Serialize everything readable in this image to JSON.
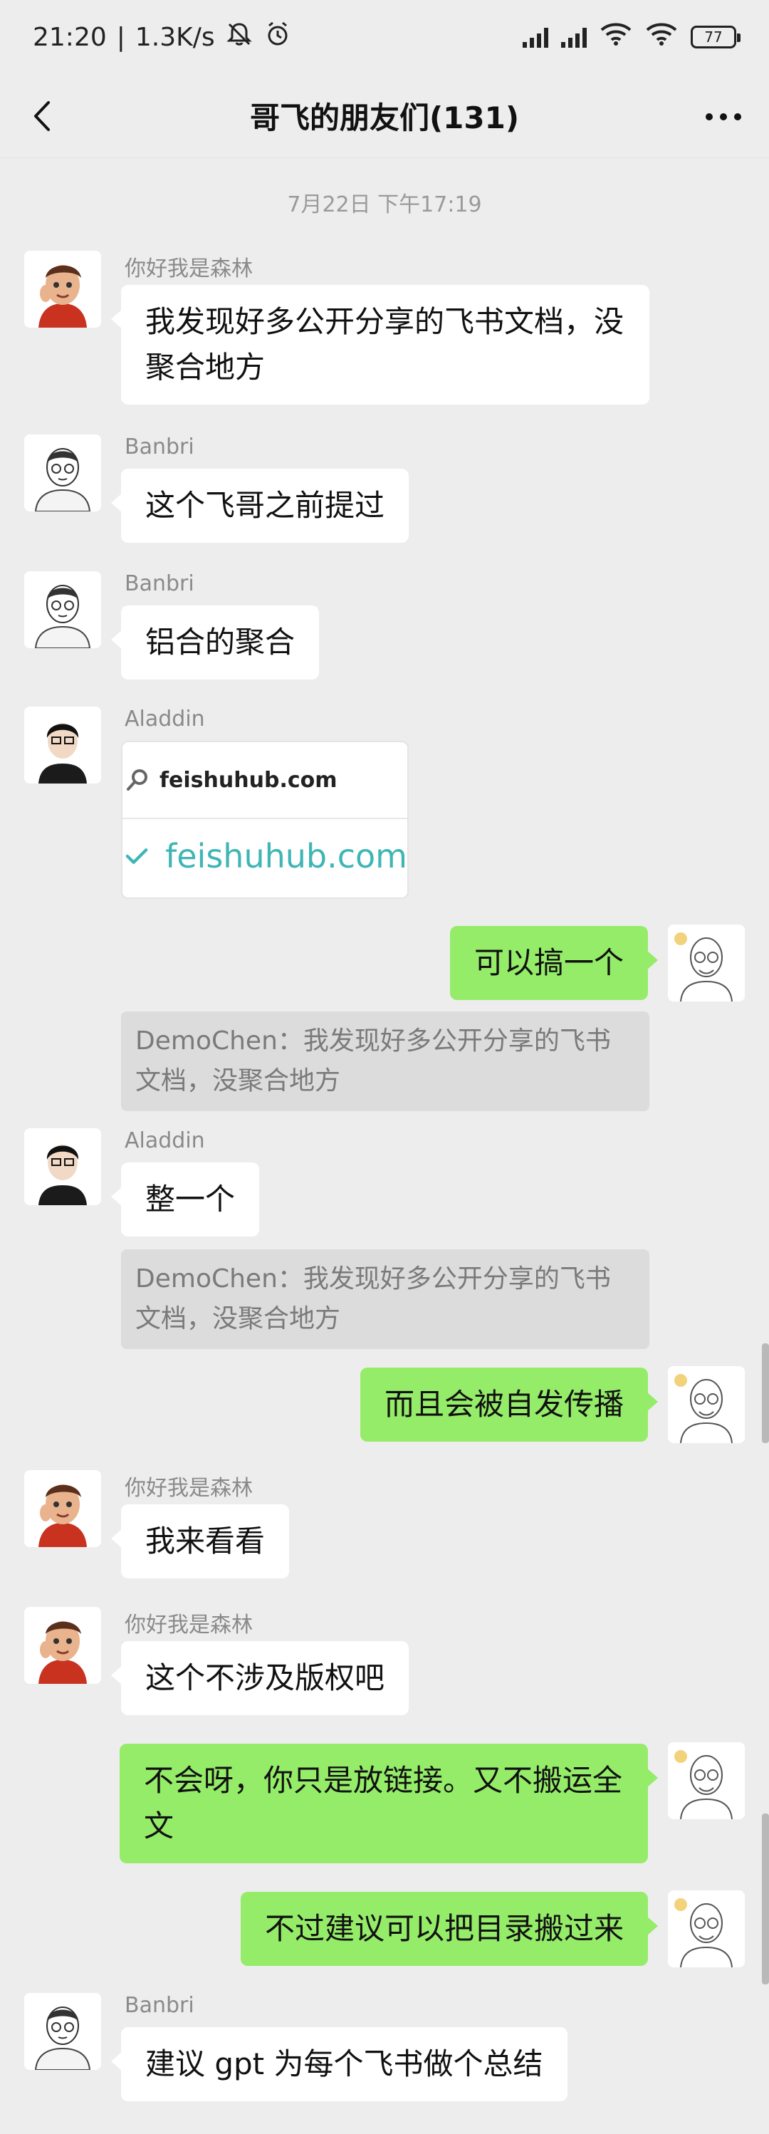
{
  "status_bar": {
    "time": "21:20",
    "speed": "1.3K/s",
    "battery": "77"
  },
  "nav": {
    "title": "哥飞的朋友们(131)"
  },
  "chat": {
    "timestamp": "7月22日 下午17:19",
    "messages": [
      {
        "sender": "你好我是森林",
        "text": "我发现好多公开分享的飞书文档，没聚合地方"
      },
      {
        "sender": "Banbri",
        "text": "这个飞哥之前提过"
      },
      {
        "sender": "Banbri",
        "text": "铝合的聚合"
      },
      {
        "sender": "Aladdin",
        "link_search": "feishuhub.com",
        "link_main": "feishuhub.com"
      },
      {
        "self": true,
        "text": "可以搞一个"
      },
      {
        "quote": "DemoChen：我发现好多公开分享的飞书文档，没聚合地方"
      },
      {
        "sender": "Aladdin",
        "text": "整一个"
      },
      {
        "quote": "DemoChen：我发现好多公开分享的飞书文档，没聚合地方"
      },
      {
        "self": true,
        "text": "而且会被自发传播"
      },
      {
        "sender": "你好我是森林",
        "text": "我来看看"
      },
      {
        "sender": "你好我是森林",
        "text": "这个不涉及版权吧"
      },
      {
        "self": true,
        "text": "不会呀，你只是放链接。又不搬运全文"
      },
      {
        "self": true,
        "text": "不过建议可以把目录搬过来"
      },
      {
        "sender": "Banbri",
        "text": "建议 gpt 为每个飞书做个总结"
      }
    ]
  },
  "colors": {
    "background": "#ededed",
    "incoming_bubble": "#ffffff",
    "outgoing_bubble": "#95ec69",
    "quote_bg": "#dcdcdc",
    "link_accent": "#3fb5b5"
  },
  "icons": {
    "back": "chevron-left-icon",
    "more": "more-dots-icon",
    "mute": "bell-off-icon",
    "alarm": "alarm-icon",
    "wifi": "wifi-icon",
    "search": "search-icon",
    "check": "check-icon"
  }
}
